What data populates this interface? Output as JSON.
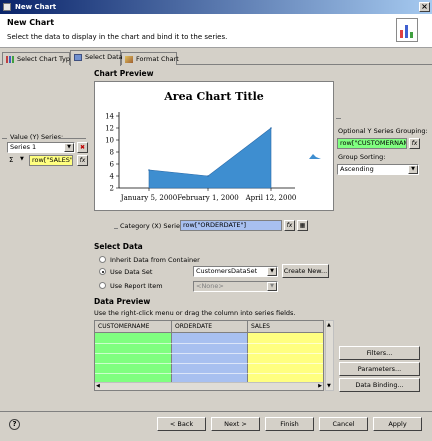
{
  "window": {
    "title": "New Chart",
    "close": "×"
  },
  "header": {
    "title": "New Chart",
    "description": "Select the data to display in the chart and bind it to the series."
  },
  "tabs": [
    {
      "label": "Select Chart Type"
    },
    {
      "label": "Select Data"
    },
    {
      "label": "Format Chart"
    }
  ],
  "chart_preview": {
    "section_label": "Chart Preview"
  },
  "chart_data": {
    "type": "area",
    "title": "Area Chart Title",
    "xlabel": "",
    "ylabel": "",
    "ylim": [
      2,
      14
    ],
    "y_ticks": [
      "14",
      "12",
      "10",
      "8",
      "6",
      "4",
      "2"
    ],
    "x_tick_labels": [
      "January 5, 2000",
      "February 1, 2000",
      "April 12, 2000"
    ],
    "x": [
      "January 5, 2000",
      "February 1, 2000",
      "April 12, 2000"
    ],
    "values": [
      5,
      4,
      12
    ],
    "color": "#3e8ed0"
  },
  "value_series": {
    "label": "Value (Y) Series:",
    "series_select": "Series 1",
    "sigma": "Σ",
    "expression": "row[\"SALES\"]"
  },
  "optional_grouping": {
    "label": "Optional Y Series Grouping:",
    "expression": "row[\"CUSTOMERNAME",
    "sorting_label": "Group Sorting:",
    "sorting_value": "Ascending"
  },
  "category_series": {
    "label": "Category (X) Series:",
    "expression": "row[\"ORDERDATE\"]"
  },
  "select_data": {
    "section_label": "Select Data",
    "options": [
      {
        "label": "Inherit Data from Container",
        "selected": false
      },
      {
        "label": "Use Data Set",
        "selected": true
      },
      {
        "label": "Use Report Item",
        "selected": false
      }
    ],
    "dataset_value": "CustomersDataSet",
    "report_item_value": "<None>",
    "create_new": "Create New..."
  },
  "data_preview": {
    "section_label": "Data Preview",
    "hint": "Use the right-click menu or drag the column into series fields.",
    "columns": [
      {
        "label": "CUSTOMERNAME",
        "color": "#80ff80"
      },
      {
        "label": "ORDERDATE",
        "color": "#a8c0f0"
      },
      {
        "label": "SALES",
        "color": "#ffff80"
      }
    ],
    "side_buttons": [
      "Filters...",
      "Parameters...",
      "Data Binding..."
    ]
  },
  "footer": {
    "help": "?",
    "back": "< Back",
    "next": "Next >",
    "finish": "Finish",
    "cancel": "Cancel",
    "apply": "Apply"
  }
}
